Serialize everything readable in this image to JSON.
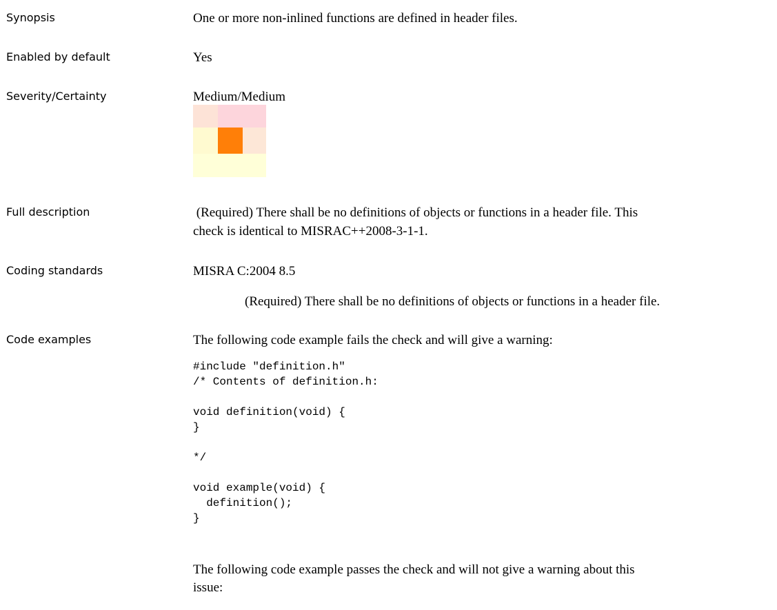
{
  "synopsis": {
    "label": "Synopsis",
    "text": "One or more non-inlined functions are defined in header files."
  },
  "enabled": {
    "label": "Enabled by default",
    "text": "Yes"
  },
  "severity": {
    "label": "Severity/Certainty",
    "text": "Medium/Medium",
    "matrix": {
      "selected": {
        "row": 1,
        "col": 1
      },
      "colors": [
        [
          "#fde3d7",
          "#fdd5dc",
          "#fdd5dc"
        ],
        [
          "#fffad0",
          "#ff7f08",
          "#fde7d7"
        ],
        [
          "#ffffd8",
          "#ffffd8",
          "#ffffd8"
        ]
      ]
    }
  },
  "full_description": {
    "label": "Full description",
    "text_line1": " (Required) There shall be no definitions of objects or functions in a header file. This",
    "text_line2": "check is identical to MISRAC++2008-3-1-1."
  },
  "coding_standards": {
    "label": "Coding standards",
    "standard": "MISRA C:2004 8.5",
    "rule": "(Required) There shall be no definitions of objects or functions in a header file."
  },
  "code_examples": {
    "label": "Code examples",
    "fail_intro": "The following code example fails the check and will give a warning:",
    "fail_code": "#include \"definition.h\"\n/* Contents of definition.h:\n\nvoid definition(void) {\n}\n\n*/\n\nvoid example(void) {\n  definition();\n}",
    "pass_intro_line1": "The following code example passes the check and will not give a warning about this",
    "pass_intro_line2": "issue:"
  }
}
